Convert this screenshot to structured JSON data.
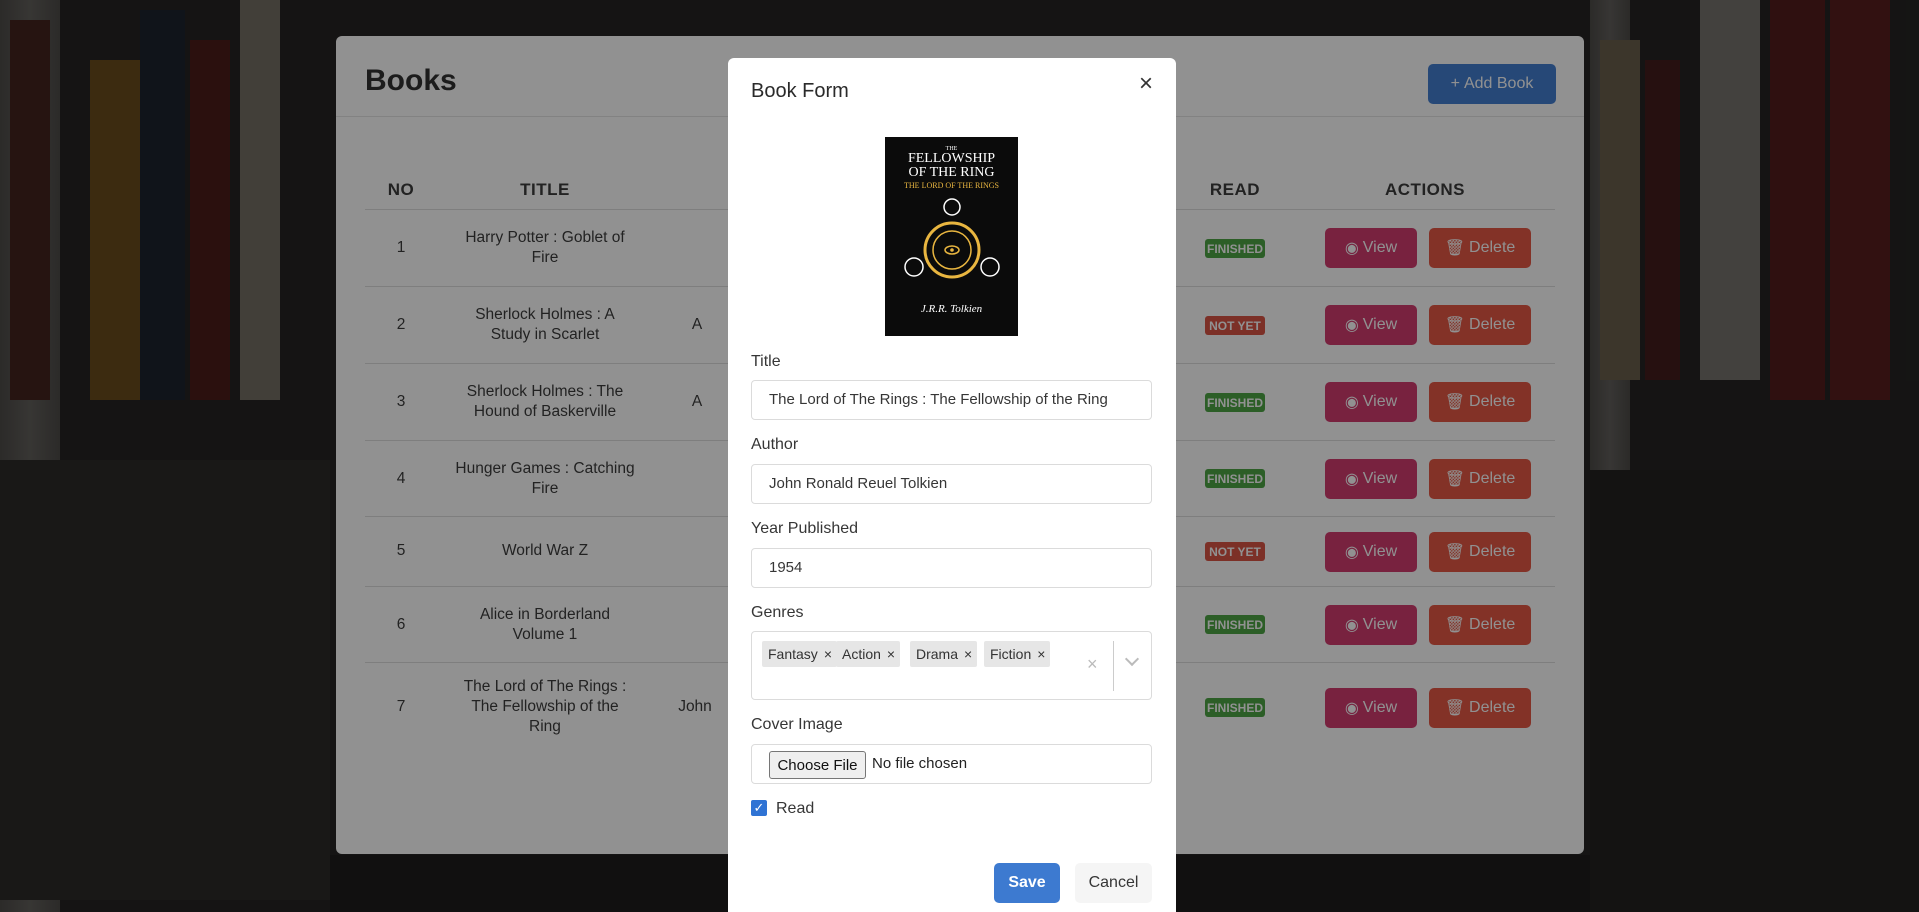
{
  "books_page": {
    "title": "Books",
    "add_button": "Add Book",
    "columns": {
      "no": "NO",
      "title": "TITLE",
      "read": "READ",
      "actions": "ACTIONS"
    },
    "rows": [
      {
        "no": "1",
        "title": "Harry Potter : Goblet of Fire",
        "author": "",
        "status": "FINISHED"
      },
      {
        "no": "2",
        "title": "Sherlock Holmes : A Study in Scarlet",
        "author": "A",
        "status": "NOT YET"
      },
      {
        "no": "3",
        "title": "Sherlock Holmes : The Hound of Baskerville",
        "author": "A",
        "status": "FINISHED"
      },
      {
        "no": "4",
        "title": "Hunger Games : Catching Fire",
        "author": "",
        "status": "FINISHED"
      },
      {
        "no": "5",
        "title": "World War Z",
        "author": "",
        "status": "NOT YET"
      },
      {
        "no": "6",
        "title": "Alice in Borderland Volume 1",
        "author": "",
        "status": "FINISHED"
      },
      {
        "no": "7",
        "title": "The Lord of The Rings : The Fellowship of the Ring",
        "author": "John",
        "status": "FINISHED"
      }
    ],
    "view_label": "View",
    "delete_label": "Delete"
  },
  "modal": {
    "title": "Book Form",
    "cover": {
      "small": "THE",
      "line1": "FELLOWSHIP",
      "line2": "OF THE RING",
      "subtitle": "THE LORD OF THE RINGS",
      "signature": "J.R.R. Tolkien"
    },
    "title_label": "Title",
    "title_value": "The Lord of The Rings : The Fellowship of the Ring",
    "author_label": "Author",
    "author_value": "John Ronald Reuel Tolkien",
    "year_label": "Year Published",
    "year_value": "1954",
    "genres_label": "Genres",
    "genres": [
      "Fantasy",
      "Action",
      "Drama",
      "Fiction"
    ],
    "cover_label": "Cover Image",
    "choose_file": "Choose File",
    "no_file": "No file chosen",
    "read_label": "Read",
    "read_checked": true,
    "save": "Save",
    "cancel": "Cancel"
  },
  "colors": {
    "primary": "#3d7ad0",
    "view": "#d1356b",
    "delete": "#e5533f",
    "finished": "#48a23f",
    "not_yet": "#d94f3f"
  }
}
